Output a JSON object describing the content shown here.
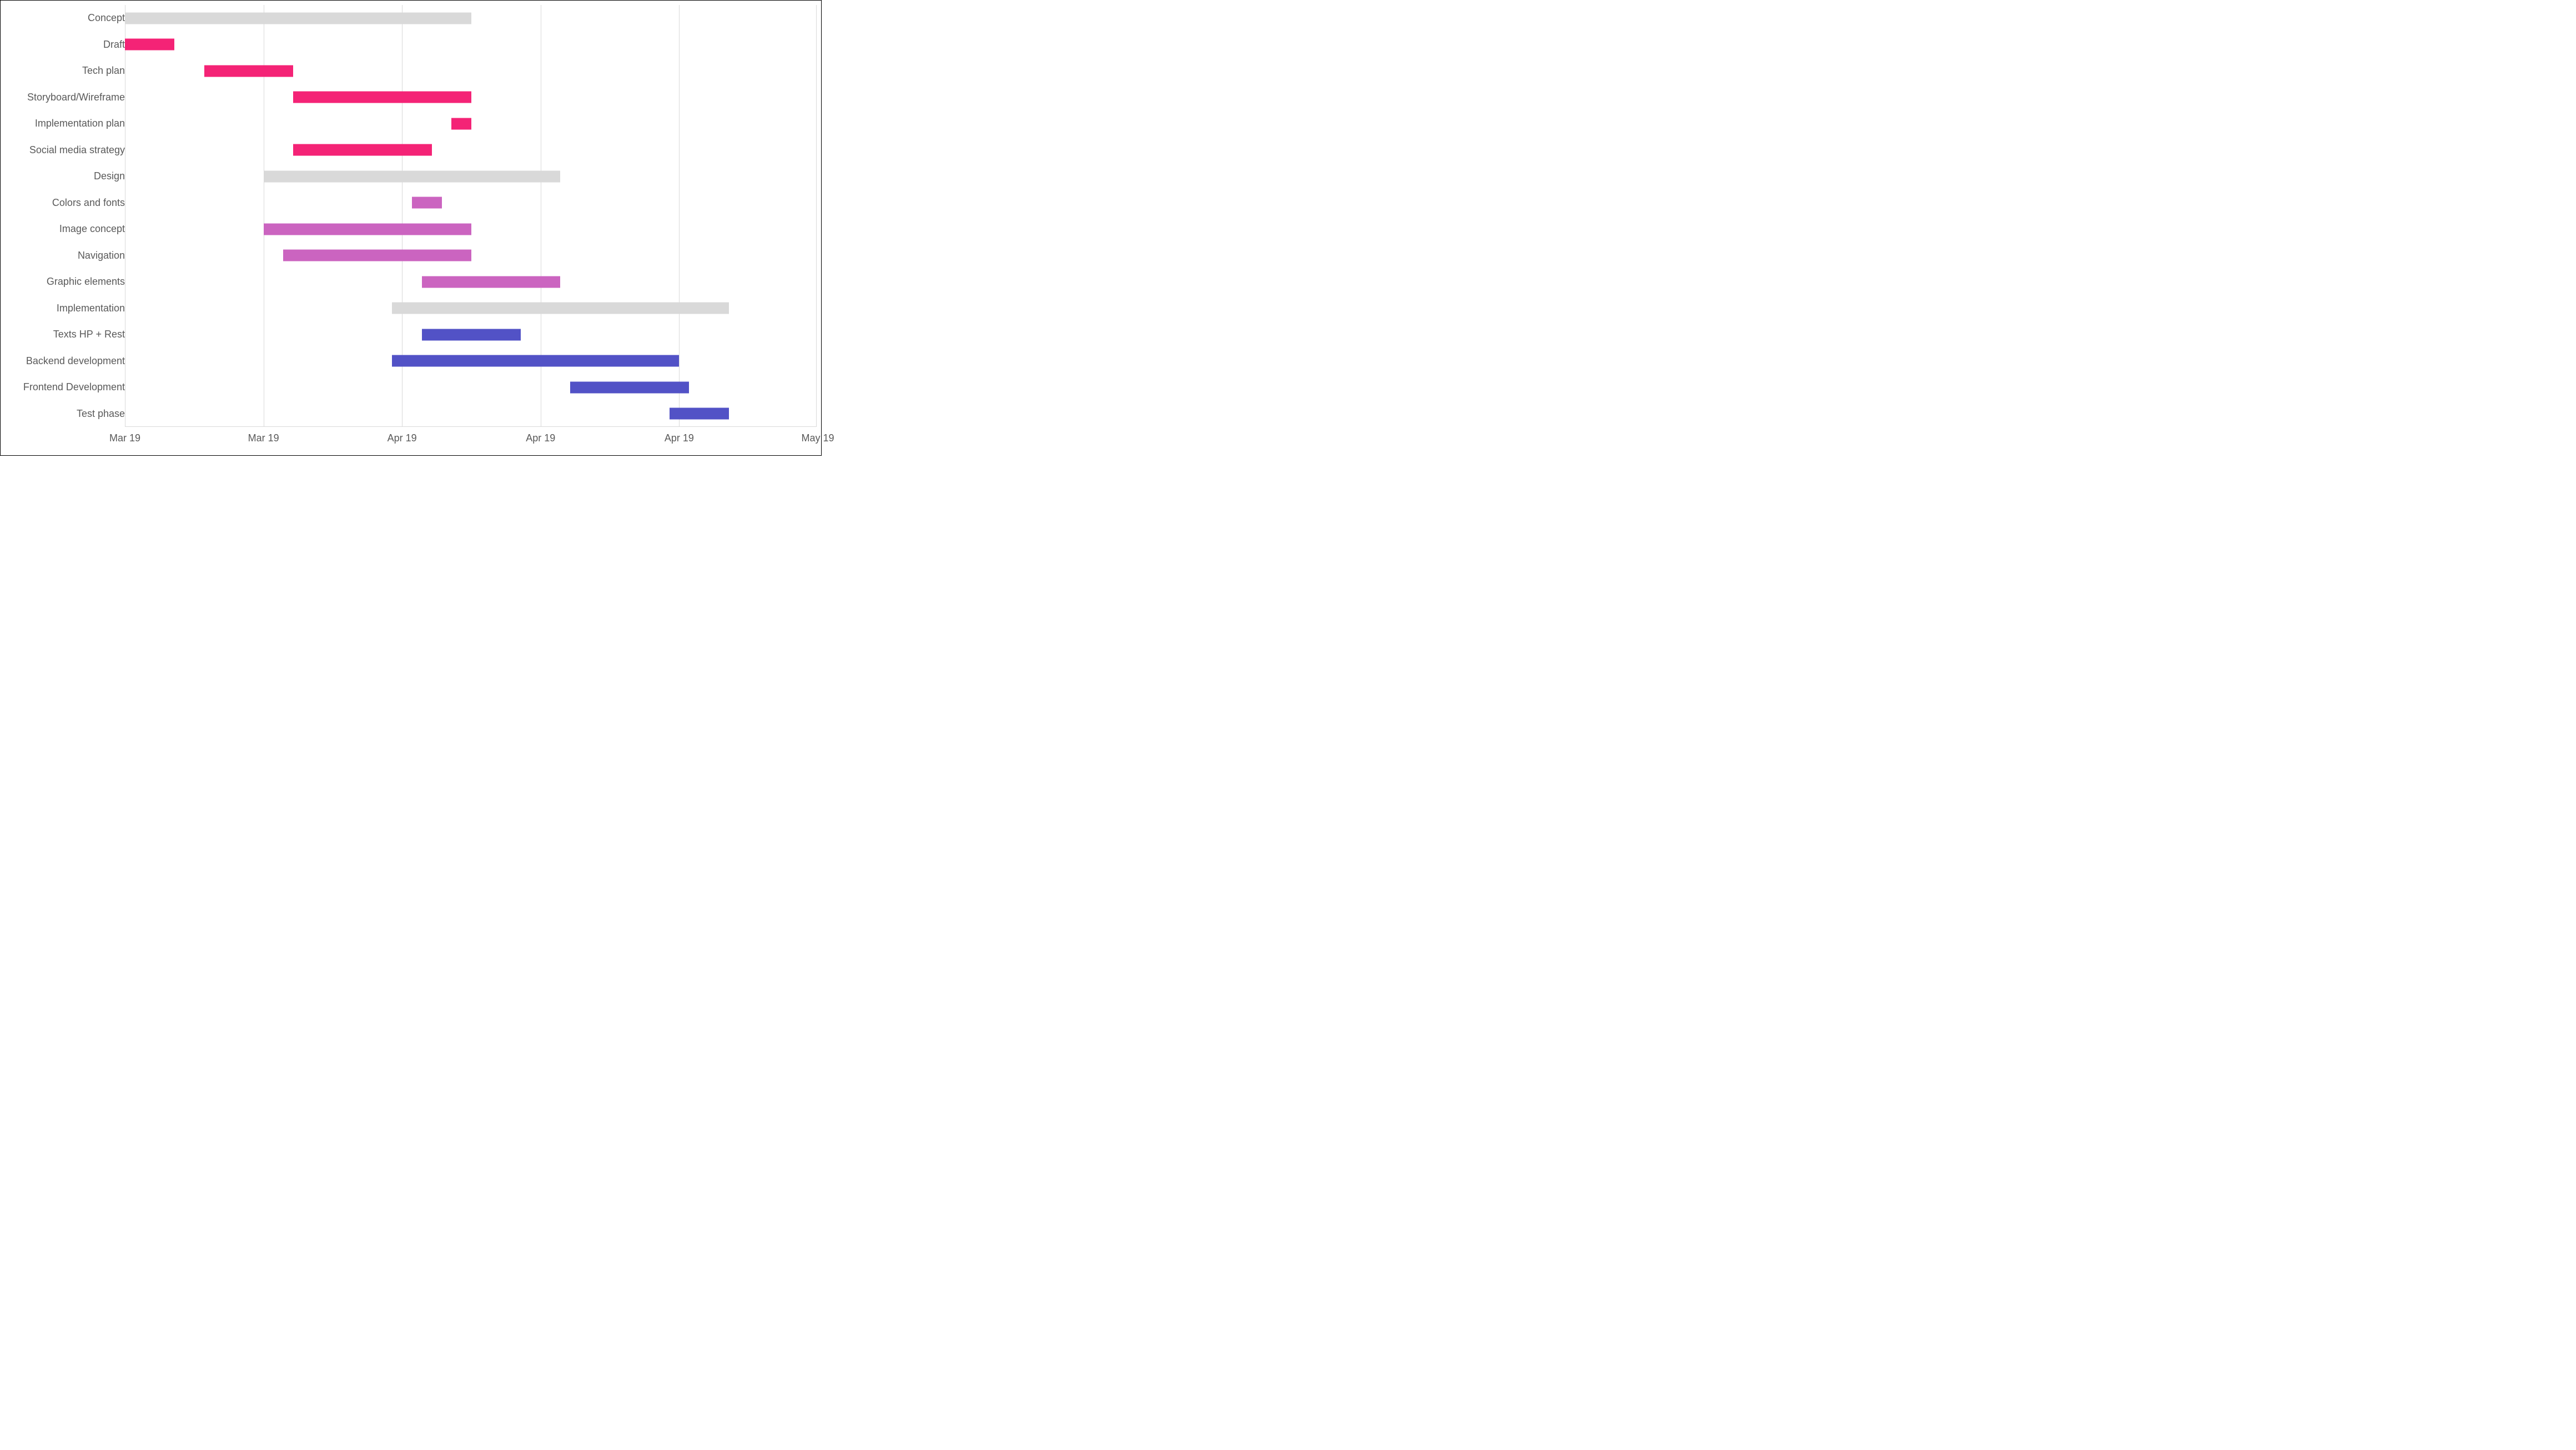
{
  "chart_data": {
    "type": "gantt",
    "title": "",
    "xlabel": "",
    "ylabel": "",
    "x_domain_days": 61,
    "x_origin": "2019-03-04",
    "colors": {
      "summary": "#d9d9d9",
      "concept": "#f42376",
      "design": "#cb64c0",
      "implementation": "#5252c6"
    },
    "x_ticks": [
      {
        "label": "Mar 19",
        "day": 0
      },
      {
        "label": "Mar 19",
        "day": 14
      },
      {
        "label": "Apr 19",
        "day": 28
      },
      {
        "label": "Apr 19",
        "day": 42
      },
      {
        "label": "Apr 19",
        "day": 56
      },
      {
        "label": "May 19",
        "day": 70
      }
    ],
    "tasks": [
      {
        "name": "Concept",
        "start": 0,
        "duration": 35,
        "color": "summary"
      },
      {
        "name": "Draft",
        "start": 0,
        "duration": 5,
        "color": "concept"
      },
      {
        "name": "Tech plan",
        "start": 8,
        "duration": 9,
        "color": "concept"
      },
      {
        "name": "Storyboard/Wireframe",
        "start": 17,
        "duration": 18,
        "color": "concept"
      },
      {
        "name": "Implementation plan",
        "start": 33,
        "duration": 2,
        "color": "concept"
      },
      {
        "name": "Social media strategy",
        "start": 17,
        "duration": 14,
        "color": "concept"
      },
      {
        "name": "Design",
        "start": 14,
        "duration": 30,
        "color": "summary"
      },
      {
        "name": "Colors and fonts",
        "start": 29,
        "duration": 3,
        "color": "design"
      },
      {
        "name": "Image concept",
        "start": 14,
        "duration": 21,
        "color": "design"
      },
      {
        "name": "Navigation",
        "start": 16,
        "duration": 19,
        "color": "design"
      },
      {
        "name": "Graphic elements",
        "start": 30,
        "duration": 14,
        "color": "design"
      },
      {
        "name": "Implementation",
        "start": 27,
        "duration": 34,
        "color": "summary"
      },
      {
        "name": "Texts HP + Rest",
        "start": 30,
        "duration": 10,
        "color": "implementation"
      },
      {
        "name": "Backend development",
        "start": 27,
        "duration": 29,
        "color": "implementation"
      },
      {
        "name": "Frontend Development",
        "start": 45,
        "duration": 12,
        "color": "implementation"
      },
      {
        "name": "Test phase",
        "start": 55,
        "duration": 6,
        "color": "implementation"
      }
    ]
  }
}
